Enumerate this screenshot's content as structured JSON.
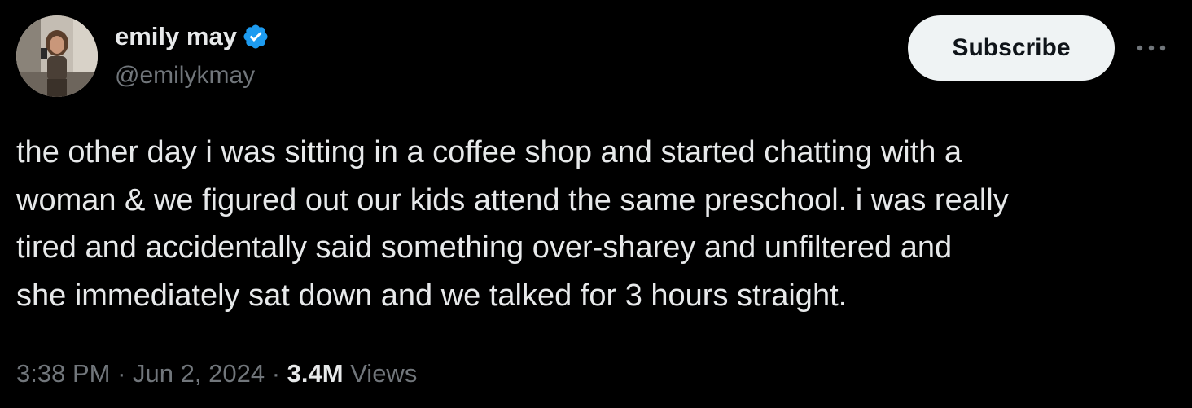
{
  "author": {
    "display_name": "emily may",
    "handle": "@emilykmay",
    "verified_icon": "verified-badge-icon",
    "verified_color": "#1d9bf0"
  },
  "actions": {
    "subscribe_label": "Subscribe",
    "more_icon": "more-horizontal-icon"
  },
  "tweet": {
    "text": "the other day i was sitting in a coffee shop and started chatting with a\nwoman & we figured out our kids attend the same preschool. i was really\ntired and accidentally said something over-sharey and unfiltered and\nshe immediately sat down and we talked for 3 hours straight."
  },
  "meta": {
    "time": "3:38 PM",
    "separator": "·",
    "date": "Jun 2, 2024",
    "views_count": "3.4M",
    "views_label": "Views"
  },
  "colors": {
    "background": "#000000",
    "primary_text": "#e7e9ea",
    "secondary_text": "#71767b",
    "button_bg": "#eff3f4",
    "button_text": "#0f1419"
  }
}
